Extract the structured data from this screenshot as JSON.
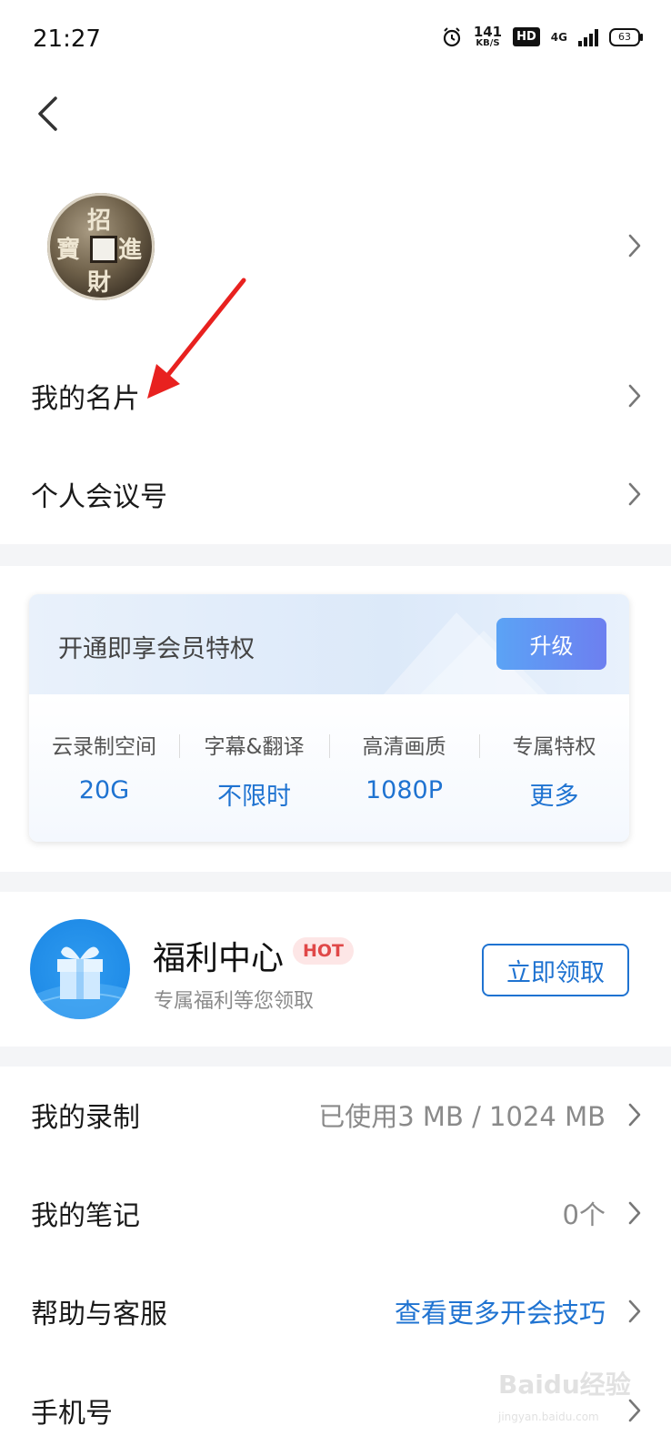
{
  "status_bar": {
    "time": "21:27",
    "net_speed_value": "141",
    "net_speed_unit": "KB/S",
    "hd_label": "HD",
    "network_label": "4G",
    "battery": "63"
  },
  "profile": {
    "my_card_label": "我的名片",
    "meeting_id_label": "个人会议号"
  },
  "vip": {
    "title": "开通即享会员特权",
    "upgrade_label": "升级",
    "benefits": [
      {
        "title": "云录制空间",
        "value": "20G"
      },
      {
        "title": "字幕&翻译",
        "value": "不限时"
      },
      {
        "title": "高清画质",
        "value": "1080P"
      },
      {
        "title": "专属特权",
        "value": "更多"
      }
    ]
  },
  "welfare": {
    "title": "福利中心",
    "badge": "HOT",
    "subtitle": "专属福利等您领取",
    "claim_label": "立即领取"
  },
  "menu": [
    {
      "label": "我的录制",
      "value": "已使用3 MB / 1024 MB"
    },
    {
      "label": "我的笔记",
      "value": "0个"
    },
    {
      "label": "帮助与客服",
      "value": "查看更多开会技巧"
    },
    {
      "label": "手机号",
      "value": ""
    }
  ],
  "watermark": {
    "text": "Baidu经验",
    "url": "jingyan.baidu.com"
  },
  "colors": {
    "accent": "#1f73d1",
    "hot": "#e04848",
    "divider": "#f4f5f7"
  }
}
